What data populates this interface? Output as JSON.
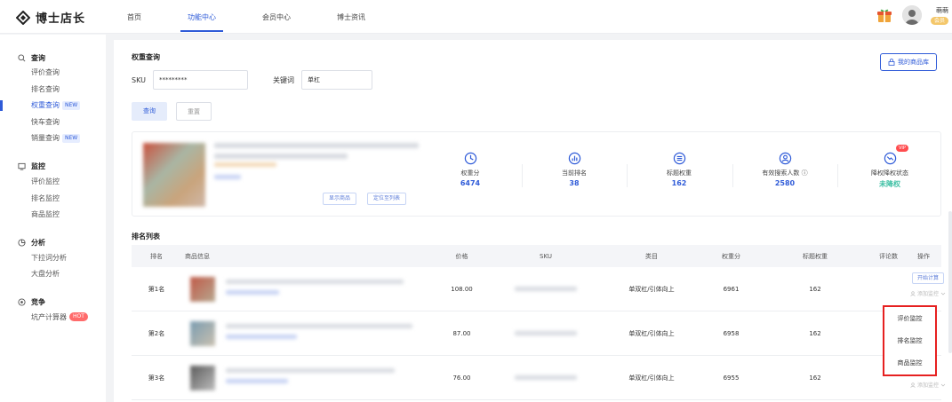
{
  "brand": {
    "name": "博士店长"
  },
  "nav": [
    "首页",
    "功能中心",
    "会员中心",
    "博士资讯"
  ],
  "user": {
    "name": "萌萌",
    "tag": "会员"
  },
  "sidebar": [
    {
      "label": "查询",
      "items": [
        {
          "label": "评价查询"
        },
        {
          "label": "排名查询"
        },
        {
          "label": "权重查询",
          "badge": "NEW",
          "active": true
        },
        {
          "label": "快车查询"
        },
        {
          "label": "销量查询",
          "badge": "NEW"
        }
      ]
    },
    {
      "label": "监控",
      "items": [
        {
          "label": "评价监控"
        },
        {
          "label": "排名监控"
        },
        {
          "label": "商品监控"
        }
      ]
    },
    {
      "label": "分析",
      "items": [
        {
          "label": "下拉词分析"
        },
        {
          "label": "大盘分析"
        }
      ]
    },
    {
      "label": "竞争",
      "items": [
        {
          "label": "坑产计算器",
          "badge": "HOT"
        }
      ]
    }
  ],
  "main": {
    "title": "权重查询",
    "my_library": "我的商品库",
    "sku_label": "SKU",
    "sku_value": "*********",
    "keyword_label": "关键词",
    "keyword_value": "单杠",
    "query_btn": "查询",
    "reset_btn": "重置",
    "card_buttons": [
      "显示商品",
      "定位至列表"
    ],
    "stats": [
      {
        "label": "权重分",
        "value": "6474"
      },
      {
        "label": "当前排名",
        "value": "38"
      },
      {
        "label": "标题权重",
        "value": "162"
      },
      {
        "label": "有效搜索人数 ⓘ",
        "value": "2580"
      },
      {
        "label": "降权降权状态",
        "value": "未降权",
        "vip": "VIP"
      }
    ],
    "list_title": "排名列表",
    "columns": [
      "排名",
      "商品信息",
      "价格",
      "SKU",
      "类目",
      "权重分",
      "标题权重",
      "评论数",
      "操作"
    ],
    "rows": [
      {
        "rank": "第1名",
        "price": "108.00",
        "category": "单双杠/引体向上",
        "weight": "6961",
        "title_weight": "162"
      },
      {
        "rank": "第2名",
        "price": "87.00",
        "category": "单双杠/引体向上",
        "weight": "6958",
        "title_weight": "162"
      },
      {
        "rank": "第3名",
        "price": "76.00",
        "category": "单双杠/引体向上",
        "weight": "6955",
        "title_weight": "162"
      }
    ],
    "row_action_btn": "开始计算",
    "add_monitor": "添加监控",
    "monitor_menu": [
      "评价监控",
      "排名监控",
      "商品监控"
    ]
  }
}
